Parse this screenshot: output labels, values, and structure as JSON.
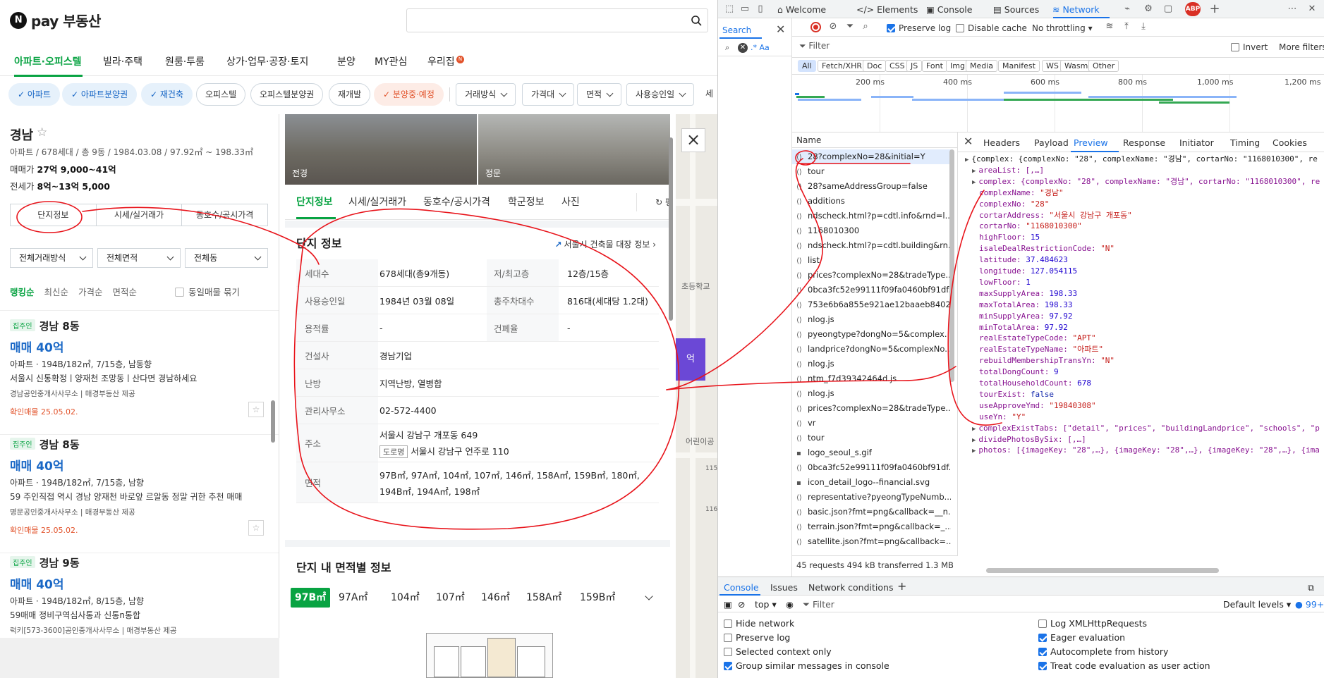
{
  "app": {
    "logo_text": "pay 부동산",
    "logo_badge": "N",
    "nav": [
      "아파트·오피스텔",
      "빌라·주택",
      "원룸·투룸",
      "상가·업무·공장·토지",
      "분양",
      "MY관심",
      "우리집"
    ],
    "nav_badge": "N",
    "chips": [
      "✓ 아파트",
      "✓ 아파트분양권",
      "✓ 재건축",
      "오피스텔",
      "오피스텔분양권",
      "재개발",
      "✓ 분양중·예정"
    ],
    "filter_dropdowns": [
      "거래방식",
      "가격대",
      "면적",
      "사용승인일",
      "세"
    ],
    "complex": {
      "name": "경남",
      "star": "☆",
      "meta": "아파트 / 678세대 / 총 9동 / 1984.03.08 / 97.92㎡ ~ 198.33㎡",
      "sale_label": "매매가",
      "sale_value": "27억 9,000~41억",
      "rent_label": "전세가",
      "rent_value": "8억~13억 5,000"
    },
    "left_tabs": [
      "단지정보",
      "시세/실거래가",
      "동호수/공시가격"
    ],
    "left_filters": [
      "전체거래방식",
      "전체면적",
      "전체동"
    ],
    "sort": [
      "랭킹순",
      "최신순",
      "가격순",
      "면적순"
    ],
    "same_listing": "동일매물 묶기",
    "listings": [
      {
        "badge": "집주인",
        "name": "경남 8동",
        "price": "매매 40억",
        "info": "아파트 · 194B/182㎡, 7/15층, 남동향",
        "desc": "서울시 신통확정ㅣ양재천 조망동ㅣ산다면 경남하세요",
        "agent": "경남공인중개사사무소 | 매경부동산 제공",
        "confirm": "확인매물 25.05.02."
      },
      {
        "badge": "집주인",
        "name": "경남 8동",
        "price": "매매 40억",
        "info": "아파트 · 194B/182㎡, 7/15층, 남향",
        "desc": "59 주인직접 역시 경남 양재천 바로앞 르알동 정말 귀한 추천 매매",
        "agent": "명문공인중개사사무소 | 매경부동산 제공",
        "confirm": "확인매물 25.05.02."
      },
      {
        "badge": "집주인",
        "name": "경남 9동",
        "price": "매매 40억",
        "info": "아파트 · 194B/182㎡, 8/15층, 남향",
        "desc": "59매매 정비구역심사통과 신통n통합",
        "agent": "럭키[573-3600]공인중개사사무소 | 매경부동산 제공",
        "confirm": ""
      }
    ],
    "detail": {
      "photo_captions": [
        "전경",
        "정문"
      ],
      "tabs": [
        "단지정보",
        "시세/실거래가",
        "동호수/공시가격",
        "학군정보",
        "사진"
      ],
      "more_tab": "평",
      "section_title": "단지 정보",
      "section_link": "서울시 건축물 대장 정보",
      "rows": [
        {
          "l1": "세대수",
          "v1": "678세대(총9개동)",
          "l2": "저/최고층",
          "v2": "12층/15층"
        },
        {
          "l1": "사용승인일",
          "v1": "1984년 03월 08일",
          "l2": "총주차대수",
          "v2": "816대(세대당 1.2대)"
        },
        {
          "l1": "용적률",
          "v1": "-",
          "l2": "건폐율",
          "v2": "-"
        },
        {
          "l1": "건설사",
          "v1": "경남기업"
        },
        {
          "l1": "난방",
          "v1": "지역난방, 열병합"
        },
        {
          "l1": "관리사무소",
          "v1": "02-572-4400"
        }
      ],
      "address_label": "주소",
      "address_jibun": "서울시 강남구 개포동 649",
      "road_tag": "도로명",
      "address_road": "서울시 강남구 언주로 110",
      "area_label": "면적",
      "area_line1": "97B㎡, 97A㎡, 104㎡, 107㎡, 146㎡, 158A㎡, 159B㎡, 180㎡,",
      "area_line2": "194B㎡, 194A㎡, 198㎡",
      "section2_title": "단지 내 면적별 정보",
      "area_tabs": [
        "97B㎡",
        "97A㎡",
        "104㎡",
        "107㎡",
        "146㎡",
        "158A㎡",
        "159B㎡"
      ]
    },
    "map_labels": [
      "초등학교",
      "어린이공",
      "115",
      "116"
    ],
    "map_button": "억"
  },
  "devtools": {
    "tabs": [
      "Welcome",
      "Elements",
      "Console",
      "Sources",
      "Network"
    ],
    "abp": "ABP",
    "search_tab": "Search",
    "search_opts": ".*  Aa",
    "toolbar": {
      "preserve_log": "Preserve log",
      "disable_cache": "Disable cache",
      "throttling": "No throttling"
    },
    "filter_placeholder": "Filter",
    "invert": "Invert",
    "more_filters": "More filters",
    "types": [
      "All",
      "Fetch/XHR",
      "Doc",
      "CSS",
      "JS",
      "Font",
      "Img",
      "Media",
      "Manifest",
      "WS",
      "Wasm",
      "Other"
    ],
    "timeline_labels": [
      "200 ms",
      "400 ms",
      "600 ms",
      "800 ms",
      "1,000 ms",
      "1,200 ms"
    ],
    "name_header": "Name",
    "requests": [
      "28?complexNo=28&initial=Y",
      "tour",
      "28?sameAddressGroup=false",
      "additions",
      "ndscheck.html?p=cdtl.info&rnd=l...",
      "1168010300",
      "ndscheck.html?p=cdtl.building&rn...",
      "list",
      "prices?complexNo=28&tradeType...",
      "0bca3fc52e99111f09fa0460bf91df...",
      "753e6b6a855e921ae12baaeb8402...",
      "nlog.js",
      "pyeongtype?dongNo=5&complex...",
      "landprice?dongNo=5&complexNo...",
      "nlog.js",
      "ntm_f7d39342464d.js",
      "nlog.js",
      "prices?complexNo=28&tradeType...",
      "vr",
      "tour",
      "logo_seoul_s.gif",
      "0bca3fc52e99111f09fa0460bf91df...",
      "icon_detail_logo--financial.svg",
      "representative?pyeongTypeNumb...",
      "basic.json?fmt=png&callback=__n...",
      "terrain.json?fmt=png&callback=_...",
      "satellite.json?fmt=png&callback=..."
    ],
    "status": "45 requests  494 kB transferred  1.3 MB",
    "preview_tabs": [
      "Headers",
      "Payload",
      "Preview",
      "Response",
      "Initiator",
      "Timing",
      "Cookies"
    ],
    "json_lines": [
      "{complex: {complexNo: \"28\", complexName: \"경남\", cortarNo: \"1168010300\", re",
      "areaList: [,…]",
      "complex: {complexNo: \"28\", complexName: \"경남\", cortarNo: \"1168010300\", re",
      "complexName: \"경남\"",
      "complexNo: \"28\"",
      "cortarAddress: \"서울시 강남구 개포동\"",
      "cortarNo: \"1168010300\"",
      "highFloor: 15",
      "isaleDealRestrictionCode: \"N\"",
      "latitude: 37.484623",
      "longitude: 127.054115",
      "lowFloor: 1",
      "maxSupplyArea: 198.33",
      "maxTotalArea: 198.33",
      "minSupplyArea: 97.92",
      "minTotalArea: 97.92",
      "realEstateTypeCode: \"APT\"",
      "realEstateTypeName: \"아파트\"",
      "rebuildMembershipTransYn: \"N\"",
      "totalDongCount: 9",
      "totalHouseholdCount: 678",
      "tourExist: false",
      "useApproveYmd: \"19840308\"",
      "useYn: \"Y\"",
      "complexExistTabs: [\"detail\", \"prices\", \"buildingLandprice\", \"schools\", \"p",
      "dividePhotosBySix: [,…]",
      "photos: [{imageKey: \"28\",…}, {imageKey: \"28\",…}, {imageKey: \"28\",…}, {ima"
    ],
    "console_tabs": [
      "Console",
      "Issues",
      "Network conditions"
    ],
    "console_context": "top",
    "console_filter": "Filter",
    "levels": "Default levels",
    "issues_count": "99+",
    "options_left": [
      "Hide network",
      "Preserve log",
      "Selected context only",
      "Group similar messages in console"
    ],
    "options_right": [
      "Log XMLHttpRequests",
      "Eager evaluation",
      "Autocomplete from history",
      "Treat code evaluation as user action"
    ],
    "options_left_checked": [
      false,
      false,
      false,
      true
    ],
    "options_right_checked": [
      false,
      true,
      true,
      true
    ]
  },
  "colors": {
    "accent_green": "#08a342",
    "price_blue": "#1a68c6",
    "devtools_blue": "#1a73e8",
    "annotation_red": "#e8141b"
  }
}
